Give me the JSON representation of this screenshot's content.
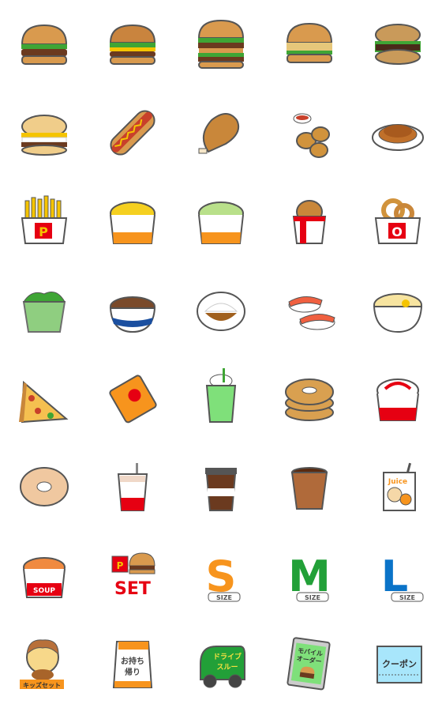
{
  "colors": {
    "outline": "#555555",
    "bun": "#d99a4e",
    "lettuce": "#3fa535",
    "patty": "#6b3a1f",
    "cheese": "#f5c400",
    "orange": "#f7941d",
    "red": "#e60012",
    "green": "#22a038",
    "blue": "#0a73c8",
    "coupon": "#a8e6fb"
  },
  "stickers": [
    {
      "name": "hamburger"
    },
    {
      "name": "cheeseburger"
    },
    {
      "name": "double-burger"
    },
    {
      "name": "chicken-burger"
    },
    {
      "name": "rice-burger"
    },
    {
      "name": "egg-muffin"
    },
    {
      "name": "hot-dog"
    },
    {
      "name": "fried-chicken"
    },
    {
      "name": "nuggets"
    },
    {
      "name": "pancakes"
    },
    {
      "name": "fries",
      "label": "P"
    },
    {
      "name": "corn-cup"
    },
    {
      "name": "salad-cup"
    },
    {
      "name": "chicken-pack"
    },
    {
      "name": "onion-rings",
      "label": "O"
    },
    {
      "name": "salad-bowl"
    },
    {
      "name": "beef-bowl"
    },
    {
      "name": "curry-rice"
    },
    {
      "name": "sushi"
    },
    {
      "name": "ramen"
    },
    {
      "name": "pizza"
    },
    {
      "name": "snack-bag"
    },
    {
      "name": "melon-float"
    },
    {
      "name": "donut-stack"
    },
    {
      "name": "sundae"
    },
    {
      "name": "donut"
    },
    {
      "name": "shake"
    },
    {
      "name": "iced-coffee"
    },
    {
      "name": "hot-coffee"
    },
    {
      "name": "juice-box",
      "label": "Juice"
    },
    {
      "name": "soup",
      "label": "SOUP"
    },
    {
      "name": "set",
      "label": "SET",
      "sub": "P"
    },
    {
      "name": "size-s",
      "label": "S",
      "sub": "SIZE"
    },
    {
      "name": "size-m",
      "label": "M",
      "sub": "SIZE"
    },
    {
      "name": "size-l",
      "label": "L",
      "sub": "SIZE"
    },
    {
      "name": "kids-set",
      "label": "キッズセット"
    },
    {
      "name": "takeout",
      "label": "お持ち",
      "sub": "帰り"
    },
    {
      "name": "drive-thru",
      "label": "ドライブ",
      "sub": "スルー"
    },
    {
      "name": "mobile-order",
      "label": "モバイル",
      "sub": "オーダー"
    },
    {
      "name": "coupon",
      "label": "クーポン"
    }
  ]
}
